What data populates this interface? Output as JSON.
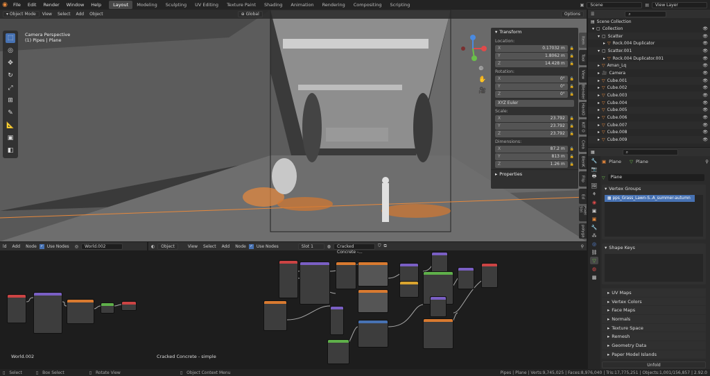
{
  "menu": [
    "File",
    "Edit",
    "Render",
    "Window",
    "Help"
  ],
  "workspaces": [
    {
      "label": "Layout",
      "active": true
    },
    {
      "label": "Modeling"
    },
    {
      "label": "Sculpting"
    },
    {
      "label": "UV Editing"
    },
    {
      "label": "Texture Paint"
    },
    {
      "label": "Shading"
    },
    {
      "label": "Animation"
    },
    {
      "label": "Rendering"
    },
    {
      "label": "Compositing"
    },
    {
      "label": "Scripting"
    }
  ],
  "scene": "Scene",
  "view_layer": "View Layer",
  "viewport": {
    "mode": "Object Mode",
    "menu": [
      "View",
      "Select",
      "Add",
      "Object"
    ],
    "orientation": "Global",
    "options": "Options",
    "overlay_title": "Camera Perspective",
    "overlay_sub": "(1) Pipes | Plane"
  },
  "npanel": {
    "title": "Transform",
    "location_label": "Location:",
    "location": [
      {
        "axis": "X",
        "value": "0.17032 m"
      },
      {
        "axis": "Y",
        "value": "1.8062 m"
      },
      {
        "axis": "Z",
        "value": "14.428 m"
      }
    ],
    "rotation_label": "Rotation:",
    "rotation": [
      {
        "axis": "X",
        "value": "0°"
      },
      {
        "axis": "Y",
        "value": "0°"
      },
      {
        "axis": "Z",
        "value": "0°"
      }
    ],
    "rotation_mode": "XYZ Euler",
    "scale_label": "Scale:",
    "scale": [
      {
        "axis": "X",
        "value": "23.792"
      },
      {
        "axis": "Y",
        "value": "23.792"
      },
      {
        "axis": "Z",
        "value": "23.792"
      }
    ],
    "dimensions_label": "Dimensions:",
    "dimensions": [
      {
        "axis": "X",
        "value": "87.2 m"
      },
      {
        "axis": "Y",
        "value": "813 m"
      },
      {
        "axis": "Z",
        "value": "1.26 m"
      }
    ],
    "properties": "Properties"
  },
  "side_tabs": [
    "Item",
    "Tool",
    "View",
    "Blender",
    "HardO",
    "KIT O",
    "Crea",
    "BlenK",
    "Flip",
    "Ed",
    "Pixel Stri",
    "polyga"
  ],
  "outliner": {
    "title": "Scene Collection",
    "rows": [
      {
        "name": "Collection",
        "indent": 0,
        "icon": "coll"
      },
      {
        "name": "Scatter",
        "indent": 1,
        "icon": "coll"
      },
      {
        "name": "Rock.004 Duplicator",
        "indent": 2,
        "icon": "mesh"
      },
      {
        "name": "Scatter.001",
        "indent": 1,
        "icon": "coll"
      },
      {
        "name": "Rock.004 Duplicator.001",
        "indent": 2,
        "icon": "mesh"
      },
      {
        "name": "Aman_Lq",
        "indent": 1,
        "icon": "mesh"
      },
      {
        "name": "Camera",
        "indent": 1,
        "icon": "cam"
      },
      {
        "name": "Cube.001",
        "indent": 1,
        "icon": "mesh"
      },
      {
        "name": "Cube.002",
        "indent": 1,
        "icon": "mesh"
      },
      {
        "name": "Cube.003",
        "indent": 1,
        "icon": "mesh"
      },
      {
        "name": "Cube.004",
        "indent": 1,
        "icon": "mesh"
      },
      {
        "name": "Cube.005",
        "indent": 1,
        "icon": "mesh"
      },
      {
        "name": "Cube.006",
        "indent": 1,
        "icon": "mesh"
      },
      {
        "name": "Cube.007",
        "indent": 1,
        "icon": "mesh"
      },
      {
        "name": "Cube.008",
        "indent": 1,
        "icon": "mesh"
      },
      {
        "name": "Cube.009",
        "indent": 1,
        "icon": "mesh"
      }
    ]
  },
  "properties": {
    "object": "Plane",
    "data": "Plane",
    "mesh_name": "Plane",
    "vertex_groups": "Vertex Groups",
    "vg_item": "pps_Grass_Lawn-S..A_summer-autumn",
    "shape_keys": "Shape Keys",
    "panels": [
      "UV Maps",
      "Vertex Colors",
      "Face Maps",
      "Normals",
      "Texture Space",
      "Remesh",
      "Geometry Data",
      "Paper Model Islands"
    ],
    "unfold": "Unfold"
  },
  "world_editor": {
    "menu": [
      "ld",
      "Add",
      "Node"
    ],
    "use_nodes": "Use Nodes",
    "world": "World.002",
    "label": "World.002"
  },
  "shader_editor": {
    "type": "Object",
    "menu": [
      "View",
      "Select",
      "Add",
      "Node"
    ],
    "use_nodes": "Use Nodes",
    "slot": "Slot 1",
    "material": "Cracked Concrete -...",
    "label": "Cracked Concrete - simple"
  },
  "status": {
    "select": "Select",
    "box": "Box Select",
    "rotate": "Rotate View",
    "context": "Object Context Menu",
    "stats": "Pipes | Plane | Verts:9,745,025 | Faces:8,976,040 | Tris:17,775,251 | Objects:1,001/156,857 | 2.92.0"
  },
  "colors": {
    "accent": "#4772b3",
    "orange": "#e8893c",
    "active_tab": "#474747"
  }
}
